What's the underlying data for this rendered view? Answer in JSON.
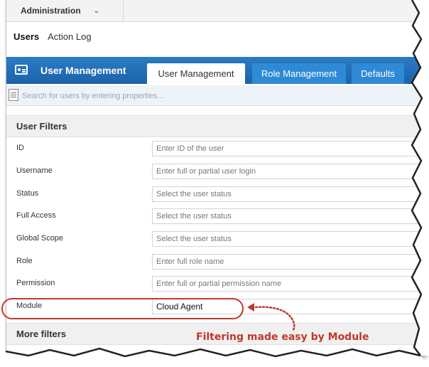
{
  "topbar": {
    "app_label": "Administration"
  },
  "subnav": {
    "items": [
      "Users",
      "Action Log"
    ]
  },
  "header": {
    "title": "User Management",
    "tabs": [
      "User Management",
      "Role Management",
      "Defaults"
    ]
  },
  "search": {
    "placeholder": "Search for users by entering properties..."
  },
  "filters": {
    "section_title": "User Filters",
    "rows": [
      {
        "label": "ID",
        "placeholder": "Enter ID of the user"
      },
      {
        "label": "Username",
        "placeholder": "Enter full or partial user login"
      },
      {
        "label": "Status",
        "placeholder": "Select the user status"
      },
      {
        "label": "Full Access",
        "placeholder": "Select the user status"
      },
      {
        "label": "Global Scope",
        "placeholder": "Select the user status"
      },
      {
        "label": "Role",
        "placeholder": "Enter full role name"
      },
      {
        "label": "Permission",
        "placeholder": "Enter full or partial permission name"
      },
      {
        "label": "Module",
        "value": "Cloud Agent"
      }
    ],
    "more_filters": "More filters"
  },
  "annotation": {
    "text": "Filtering made easy by Module"
  },
  "colors": {
    "header_blue": "#1c62a8",
    "tab_blue": "#2f8ad6",
    "annotation_red": "#c0392b"
  },
  "icons": {
    "app_chevron": "chevron-down-icon",
    "header_logo": "user-card-icon",
    "search_list": "list-icon"
  }
}
